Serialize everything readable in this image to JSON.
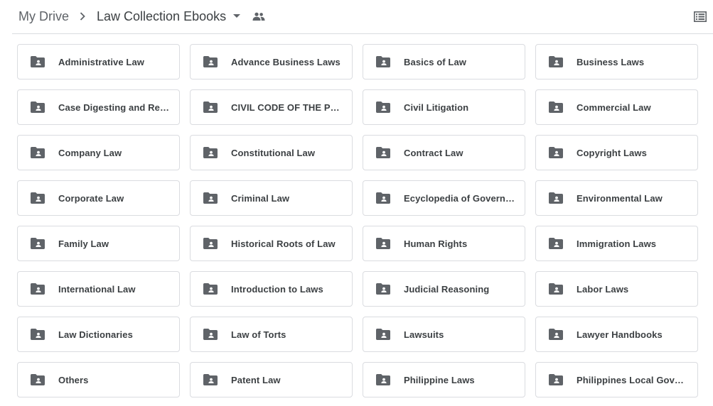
{
  "breadcrumb": {
    "root_label": "My Drive",
    "current_label": "Law Collection Ebooks"
  },
  "icons": {
    "separator": "chevron-right-icon",
    "dropdown": "arrow-drop-down-icon",
    "shared": "people-icon",
    "view_toggle": "list-view-icon",
    "folder": "shared-folder-icon"
  },
  "colors": {
    "icon_gray": "#5f6368",
    "text_dark": "#3c4043",
    "border": "#dadce0"
  },
  "folders": [
    "Administrative Law",
    "Advance Business Laws",
    "Basics of Law",
    "Business Laws",
    "Case Digesting and Repo...",
    "CIVIL CODE OF THE PHIL...",
    "Civil Litigation",
    "Commercial Law",
    "Company Law",
    "Constitutional Law",
    "Contract Law",
    "Copyright Laws",
    "Corporate Law",
    "Criminal Law",
    "Ecyclopedia of Governme...",
    "Environmental Law",
    "Family Law",
    "Historical Roots of Law",
    "Human Rights",
    "Immigration Laws",
    "International Law",
    "Introduction to Laws",
    "Judicial Reasoning",
    "Labor Laws",
    "Law Dictionaries",
    "Law of Torts",
    "Lawsuits",
    "Lawyer Handbooks",
    "Others",
    "Patent Law",
    "Philippine Laws",
    "Philippines Local Govern..."
  ]
}
